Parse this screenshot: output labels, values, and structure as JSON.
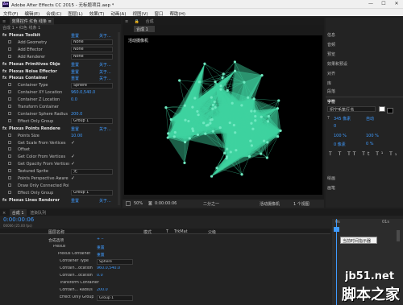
{
  "window": {
    "app_logo": "Ae",
    "title": "Adobe After Effects CC 2015 - 无标题项目.aep *",
    "min": "—",
    "max": "☐",
    "close": "✕"
  },
  "menu": [
    "文件(F)",
    "编辑(E)",
    "合成(C)",
    "图层(L)",
    "效果(T)",
    "动画(A)",
    "视图(V)",
    "窗口",
    "帮助(H)"
  ],
  "effects_panel": {
    "tab_label": "效果控件 红色 线条 ≡",
    "breadcrumb": "合成 1 • 红色 线条 1",
    "rows": [
      {
        "kind": "header",
        "label": "Plexus Toolkit",
        "value": "重置",
        "extra": "关于..."
      },
      {
        "kind": "dd",
        "label": "Add Geometry",
        "value": "None"
      },
      {
        "kind": "dd",
        "label": "Add Effector",
        "value": "None"
      },
      {
        "kind": "dd",
        "label": "Add Renderer",
        "value": "None"
      },
      {
        "kind": "header",
        "label": "Plexus Primitives Object",
        "value": "重置",
        "extra": "关于..."
      },
      {
        "kind": "header",
        "label": "Plexus Noise Effector",
        "value": "重置",
        "extra": "关于..."
      },
      {
        "kind": "header",
        "label": "Plexus Container",
        "value": "重置",
        "extra": "关于..."
      },
      {
        "kind": "dd",
        "label": "Container Type",
        "value": "Sphere"
      },
      {
        "kind": "val",
        "label": "Container XY Location",
        "value": "960.0,540.0"
      },
      {
        "kind": "val",
        "label": "Container Z Location",
        "value": "0.0"
      },
      {
        "kind": "sub",
        "label": "Transform Container"
      },
      {
        "kind": "val",
        "label": "Container Sphere Radius",
        "value": "200.0"
      },
      {
        "kind": "dd",
        "label": "Effect Only Group",
        "value": "Group 1"
      },
      {
        "kind": "header",
        "label": "Plexus Points Renderer",
        "value": "重置",
        "extra": "关于..."
      },
      {
        "kind": "val",
        "label": "Points Size",
        "value": "10.00"
      },
      {
        "kind": "check",
        "label": "Get Scale From Vertices",
        "value": "✓"
      },
      {
        "kind": "sub",
        "label": "Offset"
      },
      {
        "kind": "check",
        "label": "Get Color From Vertices",
        "value": "✓"
      },
      {
        "kind": "check",
        "label": "Get Opacity From Vertices",
        "value": "✓"
      },
      {
        "kind": "dd",
        "label": "Textured Sprite",
        "value": "无"
      },
      {
        "kind": "check",
        "label": "Points Perspective Aware",
        "value": "✓"
      },
      {
        "kind": "check",
        "label": "Draw Only Connected Poi",
        "value": ""
      },
      {
        "kind": "dd",
        "label": "Effect Only Group",
        "value": "Group 1"
      },
      {
        "kind": "header",
        "label": "Plexus Lines Renderer",
        "value": "重置",
        "extra": "关于..."
      }
    ]
  },
  "composition": {
    "tab_label": "合成 1",
    "viewer_label": "活动摄像机",
    "zoom": "50%",
    "timecode": "0:00:00:06",
    "quality": "二分之一",
    "camera": "活动摄像机",
    "views": "1 个视图"
  },
  "right_panel": {
    "items": [
      "信息",
      "音频",
      "预览",
      "效果和预设",
      "对齐",
      "库",
      "段落"
    ],
    "character": {
      "title": "字符",
      "font": "招宁毛笔行书",
      "size": "345 像素",
      "leading": "自动",
      "tracking": "0",
      "scale_v": "100 %",
      "scale_h": "100 %",
      "baseline": "0 像素",
      "tsume": "0 %"
    },
    "bottom_items": [
      "绘画",
      "画笔"
    ]
  },
  "timeline": {
    "tab_label": "合成 1",
    "tab2_label": "渲染队列",
    "timecode": "0:00:00:06",
    "fps": "00006 (25.00 fps)",
    "columns": [
      "图层名称",
      "模式",
      "T",
      "TrkMat",
      "父级"
    ],
    "rows": [
      {
        "label": "合成选项",
        "value": "+ ‒"
      },
      {
        "label": "Plexus",
        "value": "重置"
      },
      {
        "label": "Plexus Container",
        "value": "重置"
      },
      {
        "label": "Container Type",
        "dd": "Sphere"
      },
      {
        "label": "Contain...ocation",
        "value": "960.0,540.0"
      },
      {
        "label": "Contain...ocation",
        "value": "0.0"
      },
      {
        "label": "Transform Container",
        "value": ""
      },
      {
        "label": "Contain... Radius",
        "value": "200.0"
      },
      {
        "label": "Effect Only Group",
        "dd": "Group 1"
      }
    ],
    "tooltip": "当前时间指示器",
    "ruler_labels": [
      "0s",
      "01s"
    ]
  },
  "watermark": {
    "site": "jb51.net",
    "brand": "脚本之家"
  },
  "colors": {
    "accent_blue": "#3f9bff",
    "plexus_green": "#3fd2a0"
  }
}
